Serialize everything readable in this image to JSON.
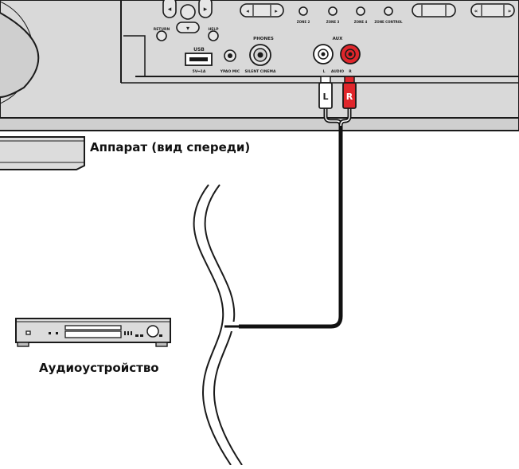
{
  "captions": {
    "device": "Аппарат (вид спереди)",
    "source": "Аудиоустройство"
  },
  "panel_labels": {
    "return": "RETURN",
    "help": "HELP",
    "usb": "USB",
    "usb_power": "5V⎓1A",
    "ypao": "YPAO MIC",
    "phones": "PHONES",
    "silent_cinema": "SILENT CINEMA",
    "aux": "AUX",
    "left": "L",
    "audio": "AUDIO",
    "right": "R",
    "zone2": "ZONE 2",
    "zone3": "ZONE 3",
    "zone4": "ZONE 4",
    "zone_control": "ZONE CONTROL",
    "plug_left": "L",
    "plug_right": "R"
  },
  "colors": {
    "panel": "#d9d9d9",
    "panel_dark": "#bdbdbd",
    "outline": "#1a1a1a",
    "right_channel": "#e0262b",
    "cable": "#111111"
  }
}
